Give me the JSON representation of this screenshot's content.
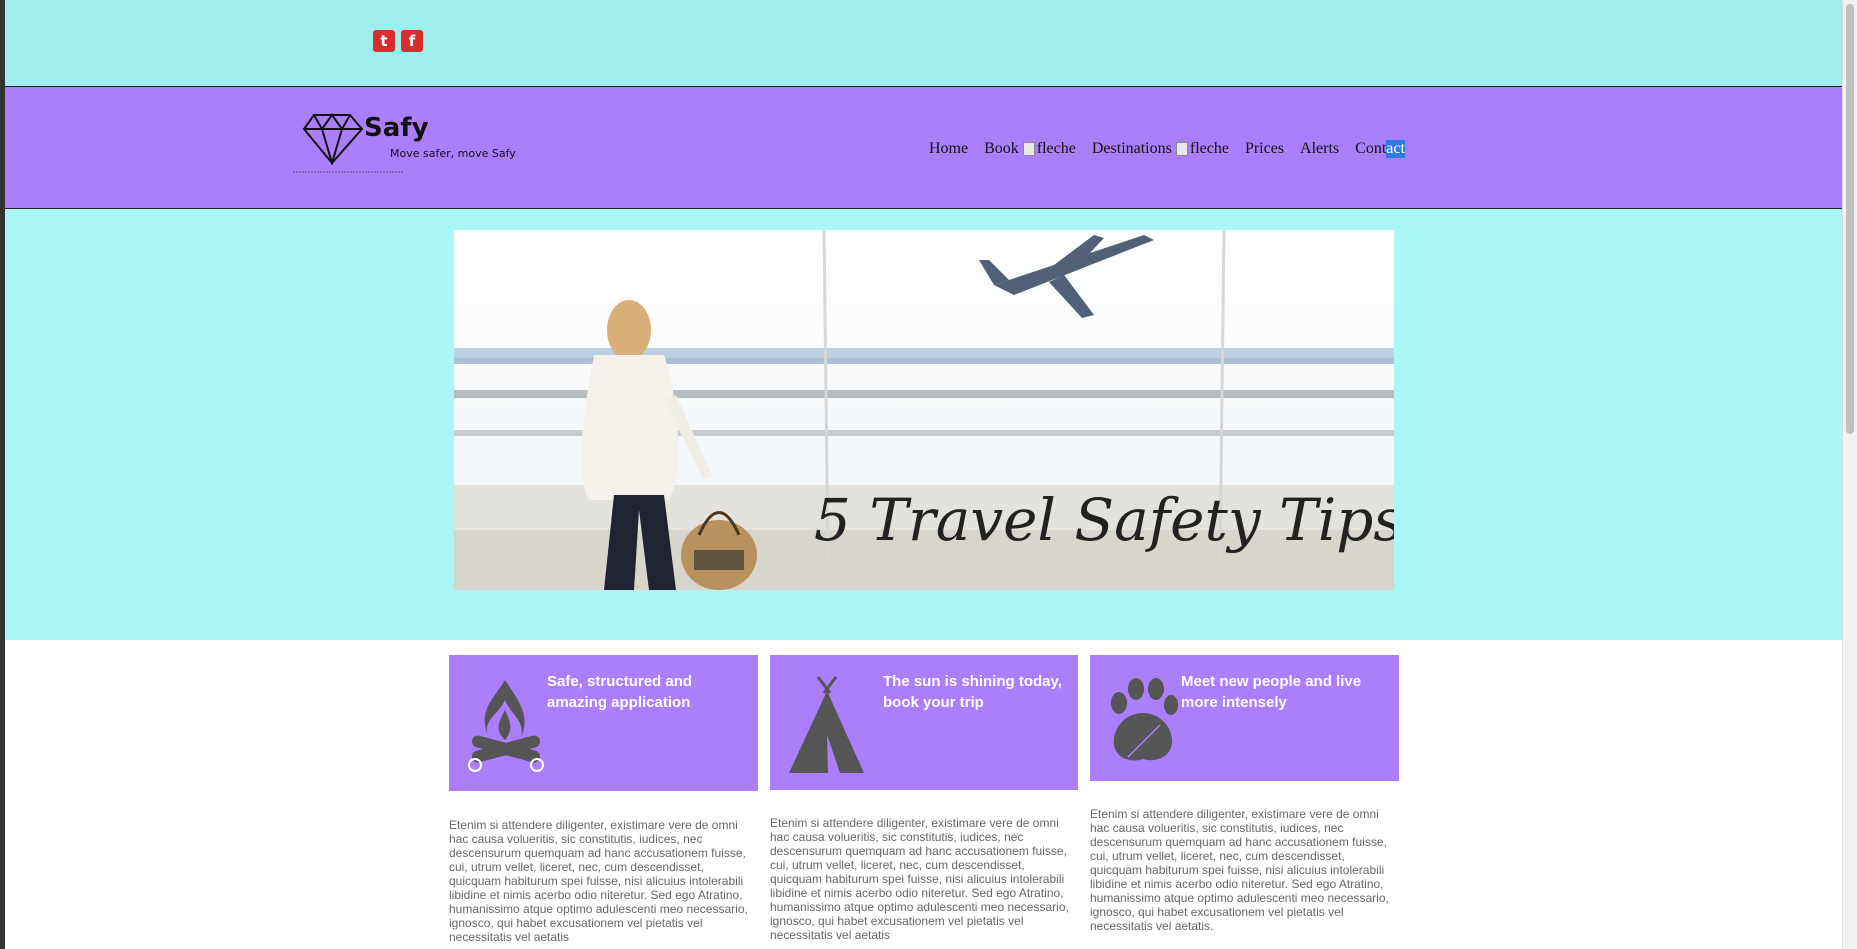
{
  "social": [
    {
      "icon": "twitter-icon",
      "glyph": "t"
    },
    {
      "icon": "facebook-icon",
      "glyph": "f"
    }
  ],
  "brand": {
    "name": "Safy",
    "tagline": "Move safer, move Safy"
  },
  "nav": {
    "items": [
      {
        "label": "Home"
      },
      {
        "label": "Book",
        "img_alt": "fleche"
      },
      {
        "label": "Destinations",
        "img_alt": "fleche"
      },
      {
        "label": "Prices"
      },
      {
        "label": "Alerts"
      },
      {
        "label_a": "Cont",
        "label_b": "act"
      }
    ]
  },
  "hero": {
    "banner_caption": "5 Travel Safety Tips"
  },
  "features": [
    {
      "title_line1": "Safe, structured and",
      "title_line2": "amazing application",
      "icon": "campfire-icon",
      "text": "Etenim si attendere diligenter, existimare vere de omni hac causa volueritis, sic constitutis, iudices, nec descensurum quemquam ad hanc accusationem fuisse, cui, utrum vellet, liceret, nec, cum descendisset, quicquam habiturum spei fuisse, nisi alicuius intolerabili libidine et nimis acerbo odio niteretur. Sed ego Atratino, humanissimo atque optimo adulescenti meo necessario, ignosco, qui habet excusationem vel pietatis vel necessitatis vel aetatis"
    },
    {
      "title_line1": "The sun is shining today,",
      "title_line2": "book your trip",
      "icon": "tent-icon",
      "text": "Etenim si attendere diligenter, existimare vere de omni hac causa volueritis, sic constitutis, iudices, nec descensurum quemquam ad hanc accusationem fuisse, cui, utrum vellet, liceret, nec, cum descendisset, quicquam habiturum spei fuisse, nisi alicuius intolerabili libidine et nimis acerbo odio niteretur. Sed ego Atratino, humanissimo atque optimo adulescenti meo necessario, ignosco, qui habet excusationem vel pietatis vel necessitatis vel aetatis"
    },
    {
      "title_line1": "Meet new people and live",
      "title_line2": "more intensely",
      "icon": "paw-icon",
      "text": "Etenim si attendere diligenter, existimare vere de omni hac causa volueritis, sic constitutis, iudices, nec descensurum quemquam ad hanc accusationem fuisse, cui, utrum vellet, liceret, nec, cum descendisset, quicquam habiturum spei fuisse, nisi alicuius intolerabili libidine et nimis acerbo odio niteretur. Sed ego Atratino, humanissimo atque optimo adulescenti meo necessario, ignosco, qui habet excusationem vel pietatis vel necessitatis vel aetatis."
    }
  ],
  "colors": {
    "topbar": "#9fefef",
    "navbar": "#ab7efc",
    "hero": "#aaf7f7",
    "card": "#ab7efc",
    "social": "#d92d2d"
  }
}
